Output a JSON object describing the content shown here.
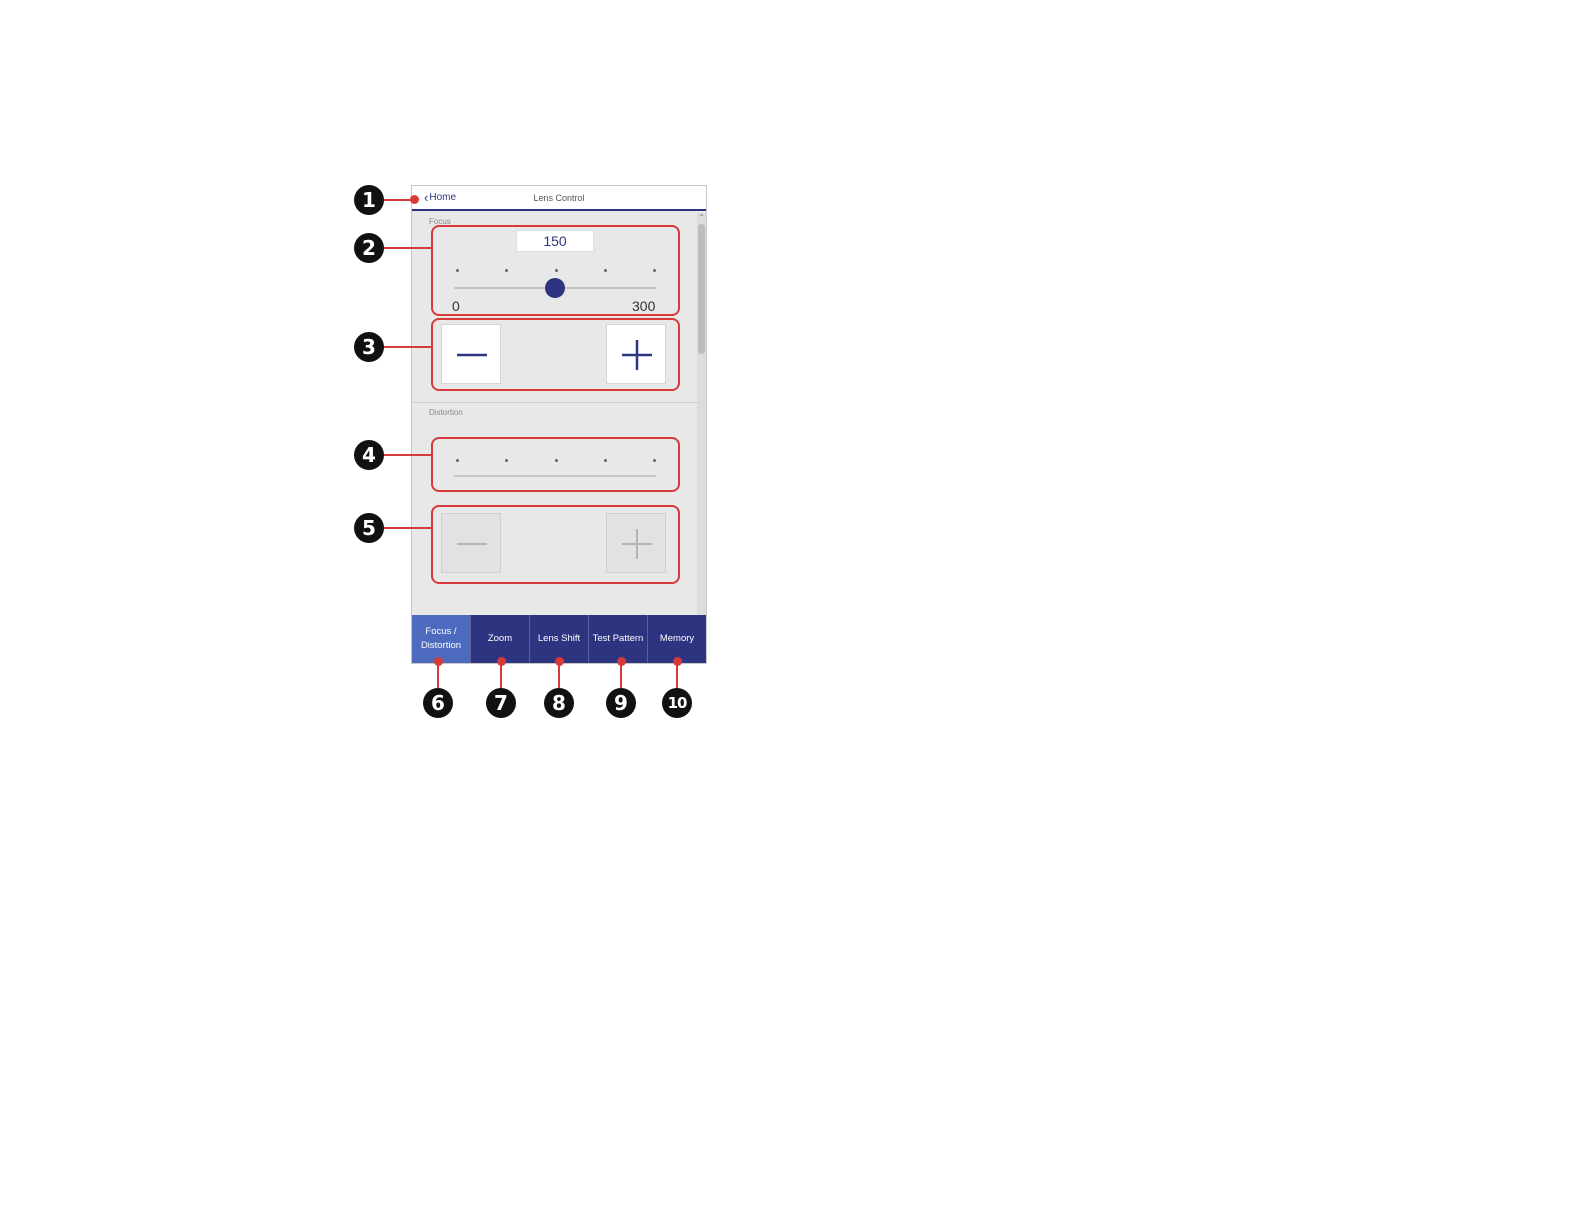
{
  "header": {
    "back_label": "Home",
    "title": "Lens Control"
  },
  "focus": {
    "section_label": "Focus",
    "value": "150",
    "min": "0",
    "max": "300",
    "level": 0.5
  },
  "distortion": {
    "section_label": "Distortion"
  },
  "tabs": [
    {
      "label": "Focus /\nDistortion",
      "active": true
    },
    {
      "label": "Zoom",
      "active": false
    },
    {
      "label": "Lens Shift",
      "active": false
    },
    {
      "label": "Test Pattern",
      "active": false
    },
    {
      "label": "Memory",
      "active": false
    }
  ],
  "callouts": [
    "1",
    "2",
    "3",
    "4",
    "5",
    "6",
    "7",
    "8",
    "9",
    "10"
  ],
  "colors": {
    "accent": "#2e3580",
    "active_tab": "#4c6bbf",
    "callout_red": "#d83a3a"
  }
}
